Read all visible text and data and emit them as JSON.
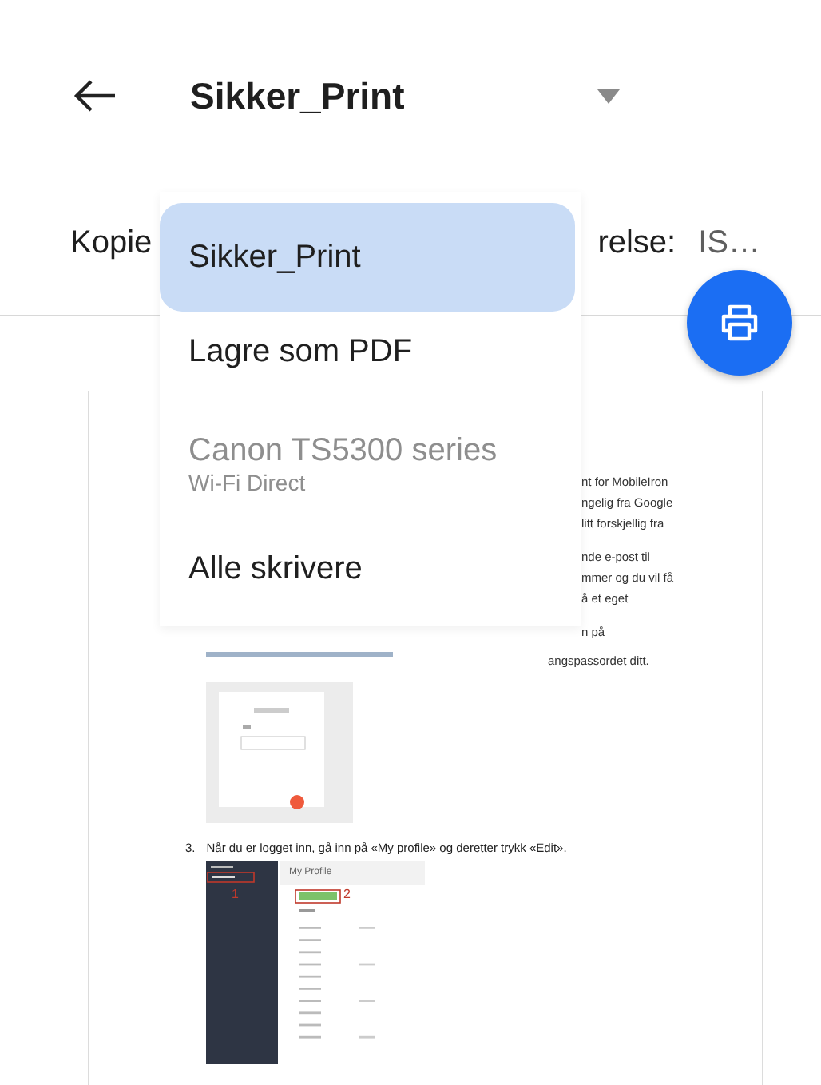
{
  "header": {
    "title": "Sikker_Print"
  },
  "settings_row": {
    "left": "Kopie",
    "right_label": "relse:",
    "right_value": "IS…"
  },
  "printer_menu": [
    {
      "label": "Sikker_Print",
      "selected": true,
      "disabled": false
    },
    {
      "label": "Lagre som PDF",
      "selected": false,
      "disabled": false
    },
    {
      "label": "Canon TS5300 series",
      "subtitle": "Wi-Fi Direct",
      "selected": false,
      "disabled": true
    },
    {
      "label": "Alle skrivere",
      "selected": false,
      "disabled": false
    }
  ],
  "preview": {
    "fragments": [
      [
        "nt for MobileIron",
        "ngelig fra Google",
        "litt forskjellig fra"
      ],
      [
        "nde e-post til",
        "mmer og du vil få",
        "å et eget"
      ],
      [
        "n på"
      ]
    ],
    "link_line_tail": "angspassordet ditt.",
    "step": {
      "number": "3.",
      "text": "Når du er logget inn, gå inn på «My profile» og deretter trykk «Edit»."
    },
    "profile_screenshot": {
      "title": "My Profile",
      "markers": [
        "1",
        "2"
      ]
    }
  }
}
